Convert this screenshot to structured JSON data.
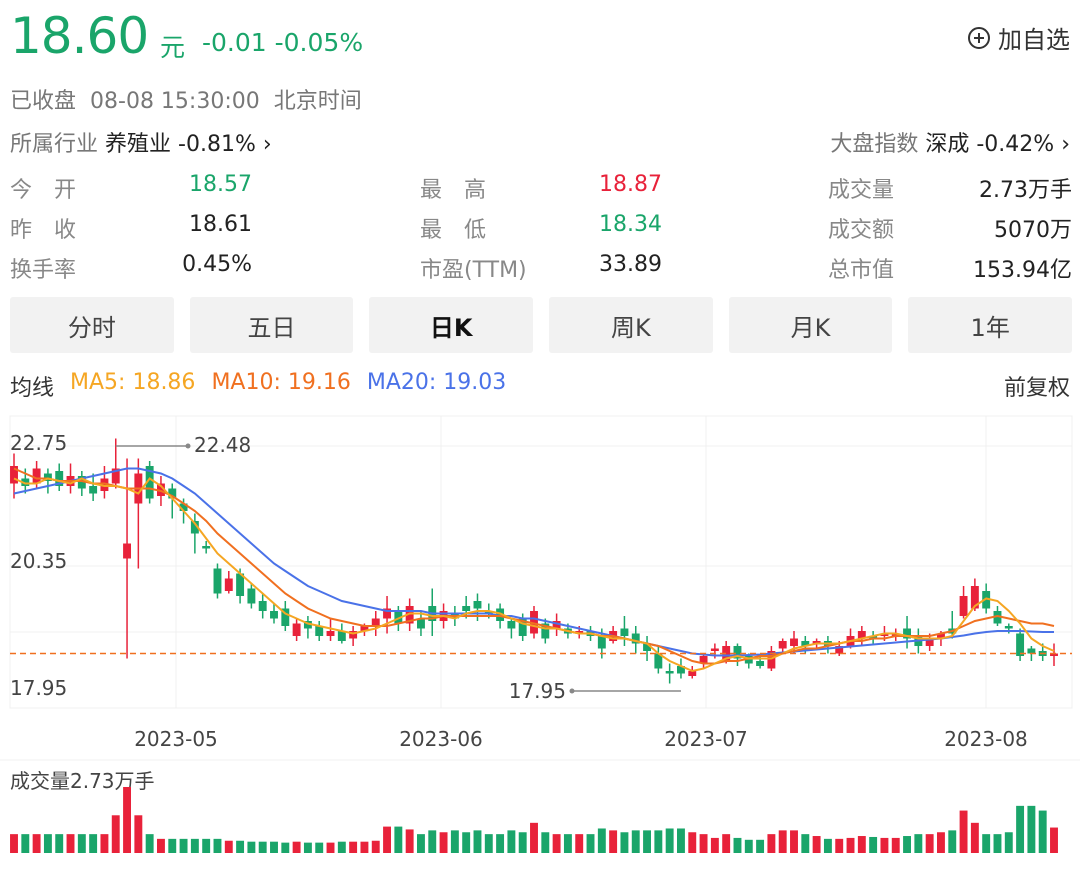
{
  "quote": {
    "price": "18.60",
    "unit": "元",
    "change": "-0.01 -0.05%",
    "add_favorite": "加自选",
    "status": "已收盘",
    "datetime": "08-08 15:30:00",
    "timezone": "北京时间"
  },
  "industry": {
    "label": "所属行业",
    "name": "养殖业",
    "change": "-0.81%"
  },
  "index": {
    "label": "大盘指数",
    "name": "深成",
    "change": "-0.42%"
  },
  "stats": [
    {
      "label": "今　开",
      "value": "18.57",
      "color": "green"
    },
    {
      "label": "最　高",
      "value": "18.87",
      "color": "red"
    },
    {
      "label": "成交量",
      "value": "2.73万手",
      "color": "dark"
    },
    {
      "label": "昨　收",
      "value": "18.61",
      "color": "dark"
    },
    {
      "label": "最　低",
      "value": "18.34",
      "color": "green"
    },
    {
      "label": "成交额",
      "value": "5070万",
      "color": "dark"
    },
    {
      "label": "换手率",
      "value": "0.45%",
      "color": "dark"
    },
    {
      "label": "市盈(TTM)",
      "value": "33.89",
      "color": "dark"
    },
    {
      "label": "总市值",
      "value": "153.94亿",
      "color": "dark"
    }
  ],
  "tabs": [
    "分时",
    "五日",
    "日K",
    "周K",
    "月K",
    "1年"
  ],
  "active_tab": "日K",
  "ma": {
    "label": "均线",
    "ma5": "MA5: 18.86",
    "ma10": "MA10: 19.16",
    "ma20": "MA20: 19.03",
    "adjust": "前复权"
  },
  "colors": {
    "up": "#e8223a",
    "down": "#1aa56a",
    "ma5": "#f5a623",
    "ma10": "#f07020",
    "ma20": "#4a72e8",
    "last_price_line": "#f07020"
  },
  "chart_data": {
    "type": "candlestick",
    "y_ticks": [
      "22.75",
      "20.35",
      "17.95"
    ],
    "ylim": [
      17.95,
      22.75
    ],
    "x_ticks": [
      "2023-05",
      "2023-06",
      "2023-07",
      "2023-08"
    ],
    "high_marker": "22.48",
    "low_marker": "17.95",
    "last_price": 18.6,
    "candles": [
      [
        22.0,
        22.35,
        22.6,
        21.7
      ],
      [
        22.1,
        21.95,
        22.3,
        21.8
      ],
      [
        22.0,
        22.3,
        22.45,
        21.9
      ],
      [
        22.2,
        22.05,
        22.3,
        21.8
      ],
      [
        22.25,
        21.95,
        22.4,
        21.85
      ],
      [
        21.95,
        22.15,
        22.4,
        21.8
      ],
      [
        22.15,
        21.9,
        22.25,
        21.75
      ],
      [
        21.95,
        21.8,
        22.2,
        21.65
      ],
      [
        21.85,
        22.1,
        22.35,
        21.7
      ],
      [
        22.0,
        22.3,
        22.9,
        21.9
      ],
      [
        20.5,
        20.8,
        22.5,
        18.5
      ],
      [
        21.6,
        22.2,
        22.5,
        20.3
      ],
      [
        22.35,
        21.7,
        22.45,
        21.6
      ],
      [
        21.75,
        22.0,
        22.15,
        21.55
      ],
      [
        21.9,
        21.7,
        22.0,
        21.3
      ],
      [
        21.6,
        21.45,
        21.7,
        21.2
      ],
      [
        21.25,
        21.0,
        21.4,
        20.6
      ],
      [
        20.75,
        20.7,
        20.85,
        20.6
      ],
      [
        20.3,
        19.8,
        20.4,
        19.7
      ],
      [
        19.85,
        20.1,
        20.25,
        19.8
      ],
      [
        20.2,
        19.75,
        20.3,
        19.6
      ],
      [
        19.9,
        19.6,
        20.0,
        19.5
      ],
      [
        19.65,
        19.45,
        19.8,
        19.3
      ],
      [
        19.45,
        19.3,
        19.6,
        19.2
      ],
      [
        19.5,
        19.15,
        19.65,
        19.05
      ],
      [
        18.95,
        19.2,
        19.3,
        18.85
      ],
      [
        19.25,
        19.1,
        19.35,
        18.9
      ],
      [
        19.15,
        18.95,
        19.25,
        18.85
      ],
      [
        18.95,
        19.05,
        19.3,
        18.85
      ],
      [
        19.05,
        18.85,
        19.2,
        18.8
      ],
      [
        18.9,
        19.05,
        19.15,
        18.75
      ],
      [
        19.05,
        19.15,
        19.2,
        18.95
      ],
      [
        19.15,
        19.3,
        19.45,
        18.95
      ],
      [
        19.3,
        19.5,
        19.75,
        19.0
      ],
      [
        19.45,
        19.2,
        19.55,
        19.05
      ],
      [
        19.2,
        19.55,
        19.7,
        19.05
      ],
      [
        19.3,
        19.1,
        19.45,
        18.95
      ],
      [
        19.55,
        19.25,
        19.9,
        18.95
      ],
      [
        19.25,
        19.45,
        19.6,
        19.1
      ],
      [
        19.4,
        19.3,
        19.55,
        19.15
      ],
      [
        19.55,
        19.45,
        19.75,
        19.3
      ],
      [
        19.65,
        19.5,
        19.8,
        19.25
      ],
      [
        19.45,
        19.4,
        19.6,
        19.3
      ],
      [
        19.5,
        19.25,
        19.6,
        19.1
      ],
      [
        19.25,
        19.1,
        19.3,
        18.9
      ],
      [
        19.3,
        18.95,
        19.4,
        18.85
      ],
      [
        19.0,
        19.45,
        19.55,
        18.9
      ],
      [
        19.2,
        18.9,
        19.3,
        18.8
      ],
      [
        19.1,
        19.25,
        19.4,
        18.95
      ],
      [
        19.1,
        19.0,
        19.2,
        18.9
      ],
      [
        19.05,
        19.05,
        19.15,
        18.9
      ],
      [
        19.05,
        18.95,
        19.15,
        18.85
      ],
      [
        18.95,
        18.7,
        19.1,
        18.5
      ],
      [
        18.85,
        19.05,
        19.15,
        18.8
      ],
      [
        19.1,
        18.95,
        19.35,
        18.75
      ],
      [
        19.0,
        18.8,
        19.15,
        18.6
      ],
      [
        18.8,
        18.65,
        18.95,
        18.45
      ],
      [
        18.6,
        18.3,
        18.75,
        18.2
      ],
      [
        18.25,
        18.2,
        18.4,
        18.0
      ],
      [
        18.35,
        18.2,
        18.5,
        18.1
      ],
      [
        18.15,
        18.25,
        18.35,
        18.1
      ],
      [
        18.4,
        18.55,
        18.6,
        18.3
      ],
      [
        18.65,
        18.7,
        18.8,
        18.5
      ],
      [
        18.45,
        18.75,
        18.85,
        18.4
      ],
      [
        18.75,
        18.5,
        18.8,
        18.35
      ],
      [
        18.55,
        18.4,
        18.6,
        18.3
      ],
      [
        18.45,
        18.35,
        18.55,
        18.3
      ],
      [
        18.3,
        18.65,
        18.75,
        18.25
      ],
      [
        18.7,
        18.85,
        18.9,
        18.6
      ],
      [
        18.75,
        18.9,
        19.05,
        18.6
      ],
      [
        18.85,
        18.75,
        18.95,
        18.6
      ],
      [
        18.8,
        18.85,
        18.9,
        18.7
      ],
      [
        18.85,
        18.75,
        18.95,
        18.6
      ],
      [
        18.6,
        18.75,
        18.85,
        18.55
      ],
      [
        18.75,
        18.95,
        19.1,
        18.7
      ],
      [
        18.9,
        19.05,
        19.15,
        18.75
      ],
      [
        18.95,
        18.9,
        19.05,
        18.8
      ],
      [
        18.95,
        19.0,
        19.15,
        18.85
      ],
      [
        18.95,
        19.0,
        19.1,
        18.85
      ],
      [
        19.1,
        18.9,
        19.35,
        18.7
      ],
      [
        18.95,
        18.75,
        19.1,
        18.6
      ],
      [
        18.75,
        18.9,
        19.0,
        18.65
      ],
      [
        18.9,
        19.0,
        19.05,
        18.75
      ],
      [
        19.1,
        19.0,
        19.45,
        18.9
      ],
      [
        19.35,
        19.75,
        19.95,
        19.3
      ],
      [
        19.5,
        19.95,
        20.1,
        19.45
      ],
      [
        19.85,
        19.5,
        20.0,
        19.4
      ],
      [
        19.45,
        19.2,
        19.55,
        19.15
      ],
      [
        19.15,
        19.1,
        19.2,
        19.0
      ],
      [
        19.0,
        18.55,
        19.1,
        18.45
      ],
      [
        18.7,
        18.6,
        18.75,
        18.45
      ],
      [
        18.65,
        18.55,
        18.8,
        18.45
      ],
      [
        18.55,
        18.6,
        18.8,
        18.35
      ]
    ],
    "ma5": [
      22.1,
      22.0,
      22.0,
      22.1,
      22.05,
      22.0,
      22.1,
      22.0,
      21.95,
      21.95,
      21.9,
      21.8,
      22.1,
      21.95,
      21.7,
      21.45,
      21.2,
      20.9,
      20.6,
      20.4,
      20.2,
      20.0,
      19.8,
      19.6,
      19.4,
      19.3,
      19.2,
      19.15,
      19.1,
      19.05,
      19.0,
      19.05,
      19.1,
      19.2,
      19.3,
      19.4,
      19.4,
      19.35,
      19.35,
      19.3,
      19.4,
      19.45,
      19.45,
      19.4,
      19.3,
      19.2,
      19.15,
      19.1,
      19.1,
      19.05,
      19.0,
      19.0,
      18.95,
      18.9,
      18.9,
      18.85,
      18.8,
      18.6,
      18.45,
      18.35,
      18.25,
      18.3,
      18.4,
      18.5,
      18.55,
      18.5,
      18.5,
      18.5,
      18.6,
      18.7,
      18.75,
      18.8,
      18.8,
      18.8,
      18.85,
      18.9,
      18.95,
      19.0,
      19.0,
      18.95,
      18.9,
      18.9,
      18.9,
      18.95,
      19.25,
      19.55,
      19.7,
      19.65,
      19.45,
      19.2,
      18.9,
      18.75,
      18.65
    ],
    "ma10": [
      22.3,
      22.2,
      22.1,
      22.1,
      22.05,
      22.05,
      22.05,
      22.0,
      22.0,
      21.95,
      21.9,
      21.9,
      21.9,
      21.85,
      21.75,
      21.6,
      21.45,
      21.25,
      21.0,
      20.8,
      20.6,
      20.4,
      20.2,
      20.0,
      19.8,
      19.65,
      19.5,
      19.4,
      19.3,
      19.25,
      19.2,
      19.15,
      19.15,
      19.15,
      19.2,
      19.25,
      19.3,
      19.3,
      19.35,
      19.35,
      19.35,
      19.35,
      19.35,
      19.35,
      19.3,
      19.25,
      19.2,
      19.15,
      19.1,
      19.05,
      19.0,
      19.0,
      18.95,
      18.95,
      18.9,
      18.85,
      18.8,
      18.75,
      18.65,
      18.55,
      18.45,
      18.4,
      18.4,
      18.45,
      18.45,
      18.5,
      18.55,
      18.55,
      18.6,
      18.65,
      18.7,
      18.7,
      18.75,
      18.8,
      18.85,
      18.85,
      18.9,
      18.9,
      18.95,
      18.95,
      18.95,
      18.95,
      19.0,
      19.05,
      19.15,
      19.25,
      19.3,
      19.35,
      19.3,
      19.25,
      19.2,
      19.2,
      19.15
    ],
    "ma20": [
      21.8,
      21.85,
      21.9,
      21.95,
      22.0,
      22.05,
      22.1,
      22.15,
      22.2,
      22.25,
      22.3,
      22.3,
      22.25,
      22.2,
      22.1,
      21.95,
      21.8,
      21.6,
      21.4,
      21.2,
      21.0,
      20.8,
      20.6,
      20.4,
      20.25,
      20.1,
      19.95,
      19.85,
      19.75,
      19.65,
      19.6,
      19.55,
      19.5,
      19.45,
      19.45,
      19.45,
      19.45,
      19.4,
      19.4,
      19.4,
      19.4,
      19.4,
      19.4,
      19.35,
      19.35,
      19.3,
      19.3,
      19.25,
      19.2,
      19.15,
      19.1,
      19.05,
      19.0,
      18.95,
      18.9,
      18.85,
      18.8,
      18.75,
      18.7,
      18.65,
      18.6,
      18.58,
      18.56,
      18.56,
      18.56,
      18.57,
      18.58,
      18.6,
      18.62,
      18.64,
      18.66,
      18.68,
      18.7,
      18.72,
      18.74,
      18.76,
      18.78,
      18.8,
      18.82,
      18.84,
      18.86,
      18.88,
      18.9,
      18.93,
      18.96,
      19.0,
      19.03,
      19.05,
      19.05,
      19.05,
      19.04,
      19.03,
      19.03
    ],
    "volume_label": "成交量2.73万手",
    "volumes": [
      2,
      2,
      2,
      2,
      2,
      2,
      2,
      2,
      2,
      4,
      7,
      4,
      2,
      1.5,
      1.5,
      1.5,
      1.5,
      1.5,
      1.5,
      1.3,
      1.3,
      1.2,
      1.2,
      1.2,
      1.1,
      1.2,
      1.1,
      1.1,
      1.1,
      1.2,
      1.2,
      1.2,
      1.3,
      2.8,
      2.8,
      2.5,
      2,
      2.4,
      2.2,
      2.4,
      2.2,
      2.4,
      2,
      2,
      2.4,
      2.2,
      3.2,
      2.2,
      2,
      2,
      2,
      2,
      2.6,
      2.4,
      2.2,
      2.4,
      2.4,
      2.4,
      2.6,
      2.6,
      2.2,
      2,
      1.6,
      2,
      1.6,
      1.4,
      1.4,
      2,
      2.4,
      2.4,
      2,
      1.8,
      1.5,
      1.5,
      1.6,
      1.8,
      1.7,
      1.6,
      1.6,
      1.8,
      2,
      2,
      2.2,
      2.4,
      4.5,
      3.2,
      2,
      2,
      2.2,
      5,
      5,
      4.5,
      2.7
    ]
  }
}
